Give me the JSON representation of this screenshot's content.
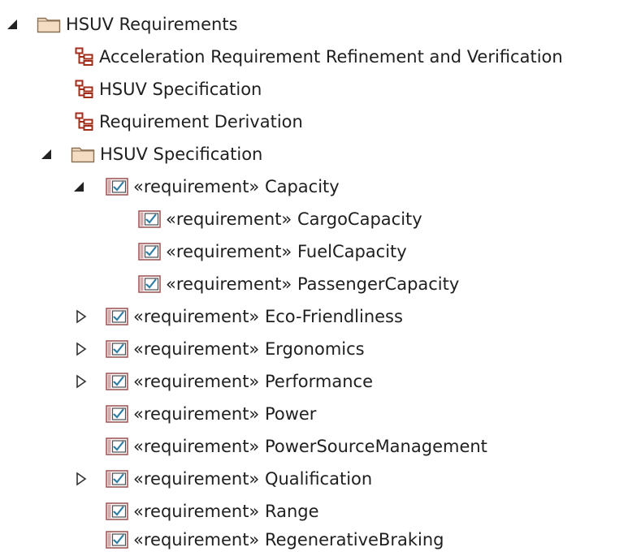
{
  "tree": {
    "root": {
      "label": "HSUV Requirements",
      "children": {
        "diagram_1": "Acceleration Requirement Refinement and Verification",
        "diagram_2": "HSUV Specification",
        "diagram_3": "Requirement Derivation",
        "package": {
          "label": "HSUV Specification",
          "requirements": [
            {
              "label": "«requirement» Capacity",
              "state": "expanded",
              "children": [
                "«requirement» CargoCapacity",
                "«requirement» FuelCapacity",
                "«requirement» PassengerCapacity"
              ]
            },
            {
              "label": "«requirement» Eco-Friendliness",
              "state": "collapsed"
            },
            {
              "label": "«requirement» Ergonomics",
              "state": "collapsed"
            },
            {
              "label": "«requirement» Performance",
              "state": "collapsed"
            },
            {
              "label": "«requirement» Power",
              "state": "leaf"
            },
            {
              "label": "«requirement» PowerSourceManagement",
              "state": "leaf"
            },
            {
              "label": "«requirement» Qualification",
              "state": "collapsed"
            },
            {
              "label": "«requirement» Range",
              "state": "leaf"
            },
            {
              "label": "«requirement» RegenerativeBraking",
              "state": "leaf"
            }
          ]
        }
      }
    }
  },
  "icons": {
    "expanded": "expanded-triangle-icon",
    "collapsed": "collapsed-triangle-icon",
    "folder": "folder-icon",
    "diagram": "diagram-icon",
    "requirement": "requirement-icon"
  },
  "colors": {
    "folder_fill": "#f4dcc3",
    "folder_stroke": "#8a7055",
    "diagram": "#a42b1a",
    "requirement_frame": "#a25a5a",
    "requirement_check": "#2d7fa6",
    "text": "#1f1f1f"
  }
}
